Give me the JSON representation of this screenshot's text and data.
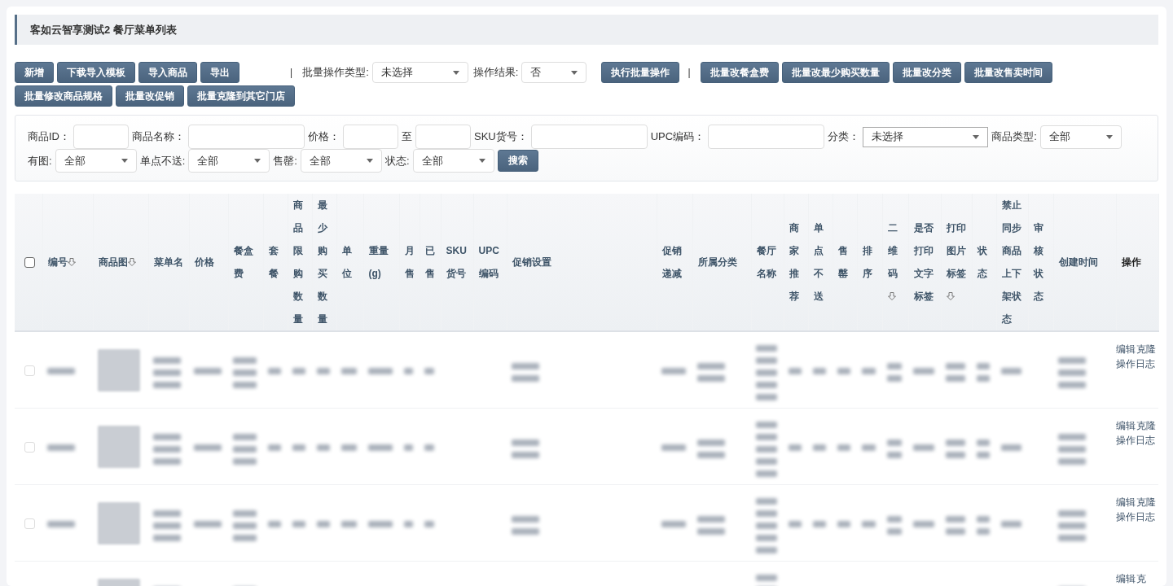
{
  "title": "客如云智享测试2 餐厅菜单列表",
  "toolbar": [
    {
      "kind": "button",
      "label": "新增"
    },
    {
      "kind": "button",
      "label": "下载导入模板"
    },
    {
      "kind": "button",
      "label": "导入商品"
    },
    {
      "kind": "button",
      "label": "导出"
    },
    {
      "kind": "separator",
      "label": "|"
    },
    {
      "kind": "select",
      "label": "批量操作类型:",
      "value": "未选择"
    },
    {
      "kind": "select",
      "label": "操作结果:",
      "value": "否"
    },
    {
      "kind": "button",
      "label": "执行批量操作"
    },
    {
      "kind": "separator",
      "label": "|"
    },
    {
      "kind": "button",
      "label": "批量改餐盒费"
    },
    {
      "kind": "button",
      "label": "批量改最少购买数量"
    },
    {
      "kind": "button",
      "label": "批量改分类"
    },
    {
      "kind": "button",
      "label": "批量改售卖时间"
    },
    {
      "kind": "button",
      "label": "批量修改商品规格"
    },
    {
      "kind": "button",
      "label": "批量改促销"
    },
    {
      "kind": "button",
      "label": "批量克隆到其它门店"
    }
  ],
  "filters": [
    {
      "kind": "label",
      "text": "商品ID："
    },
    {
      "kind": "input"
    },
    {
      "kind": "label",
      "text": "商品名称："
    },
    {
      "kind": "input"
    },
    {
      "kind": "label",
      "text": "价格："
    },
    {
      "kind": "input"
    },
    {
      "kind": "label",
      "text": "至"
    },
    {
      "kind": "input"
    },
    {
      "kind": "label",
      "text": "SKU货号："
    },
    {
      "kind": "input"
    },
    {
      "kind": "label",
      "text": "UPC编码："
    },
    {
      "kind": "input"
    },
    {
      "kind": "label",
      "text": "分类："
    },
    {
      "kind": "select",
      "value": "未选择"
    },
    {
      "kind": "label",
      "text": "商品类型:"
    },
    {
      "kind": "select",
      "value": "全部"
    },
    {
      "kind": "label",
      "text": "有图:"
    },
    {
      "kind": "select",
      "value": "全部"
    },
    {
      "kind": "label",
      "text": "单点不送:"
    },
    {
      "kind": "select",
      "value": "全部"
    },
    {
      "kind": "label",
      "text": "售罄:"
    },
    {
      "kind": "select",
      "value": "全部"
    },
    {
      "kind": "label",
      "text": "状态:"
    },
    {
      "kind": "select",
      "value": "全部"
    },
    {
      "kind": "button",
      "text": "搜索"
    }
  ],
  "table": {
    "header_checkbox": {
      "checked": false
    },
    "columns": [
      {
        "label": "编号",
        "sortable": true
      },
      {
        "label": "商品图",
        "sortable": true
      },
      {
        "label": "菜单名",
        "sortable": false
      },
      {
        "label": "价格",
        "sortable": false
      },
      {
        "label": "餐盒费",
        "sortable": false
      },
      {
        "label": "套餐",
        "sortable": false
      },
      {
        "label": "商品限购数量",
        "sortable": false
      },
      {
        "label": "最少购买数量",
        "sortable": false
      },
      {
        "label": "单位",
        "sortable": false
      },
      {
        "label": "重量(g)",
        "sortable": false
      },
      {
        "label": "月售",
        "sortable": false
      },
      {
        "label": "已售",
        "sortable": false
      },
      {
        "label": "SKU货号",
        "sortable": false
      },
      {
        "label": "UPC编码",
        "sortable": false
      },
      {
        "label": "促销设置",
        "sortable": false
      },
      {
        "label": "促销递减",
        "sortable": false
      },
      {
        "label": "所属分类",
        "sortable": false
      },
      {
        "label": "餐厅名称",
        "sortable": false
      },
      {
        "label": "商家推荐",
        "sortable": false
      },
      {
        "label": "单点不送",
        "sortable": false
      },
      {
        "label": "售罄",
        "sortable": false
      },
      {
        "label": "排序",
        "sortable": false
      },
      {
        "label": "二维码",
        "sortable": true
      },
      {
        "label": "是否打印文字标签",
        "sortable": false
      },
      {
        "label": "打印图片标签",
        "sortable": true
      },
      {
        "label": "状态",
        "sortable": false
      },
      {
        "label": "禁止同步商品上下架状态",
        "sortable": false
      },
      {
        "label": "审核状态",
        "sortable": false
      },
      {
        "label": "创建时间",
        "sortable": false
      },
      {
        "label": "操作",
        "sortable": false
      }
    ],
    "rows": [
      {
        "checked": false,
        "actions": [
          "编辑",
          "克隆",
          "操作日志"
        ]
      },
      {
        "checked": false,
        "actions": [
          "编辑",
          "克隆",
          "操作日志"
        ]
      },
      {
        "checked": false,
        "actions": [
          "编辑",
          "克隆",
          "操作日志"
        ]
      },
      {
        "actions": [
          "编辑",
          "克"
        ]
      }
    ]
  }
}
